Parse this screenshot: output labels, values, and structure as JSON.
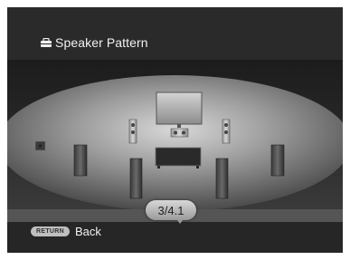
{
  "header": {
    "title": "Speaker Pattern",
    "icon": "speaker-setup-icon"
  },
  "indicator": {
    "value": "3/4.1"
  },
  "footer": {
    "button_label": "RETURN",
    "back_label": "Back"
  }
}
